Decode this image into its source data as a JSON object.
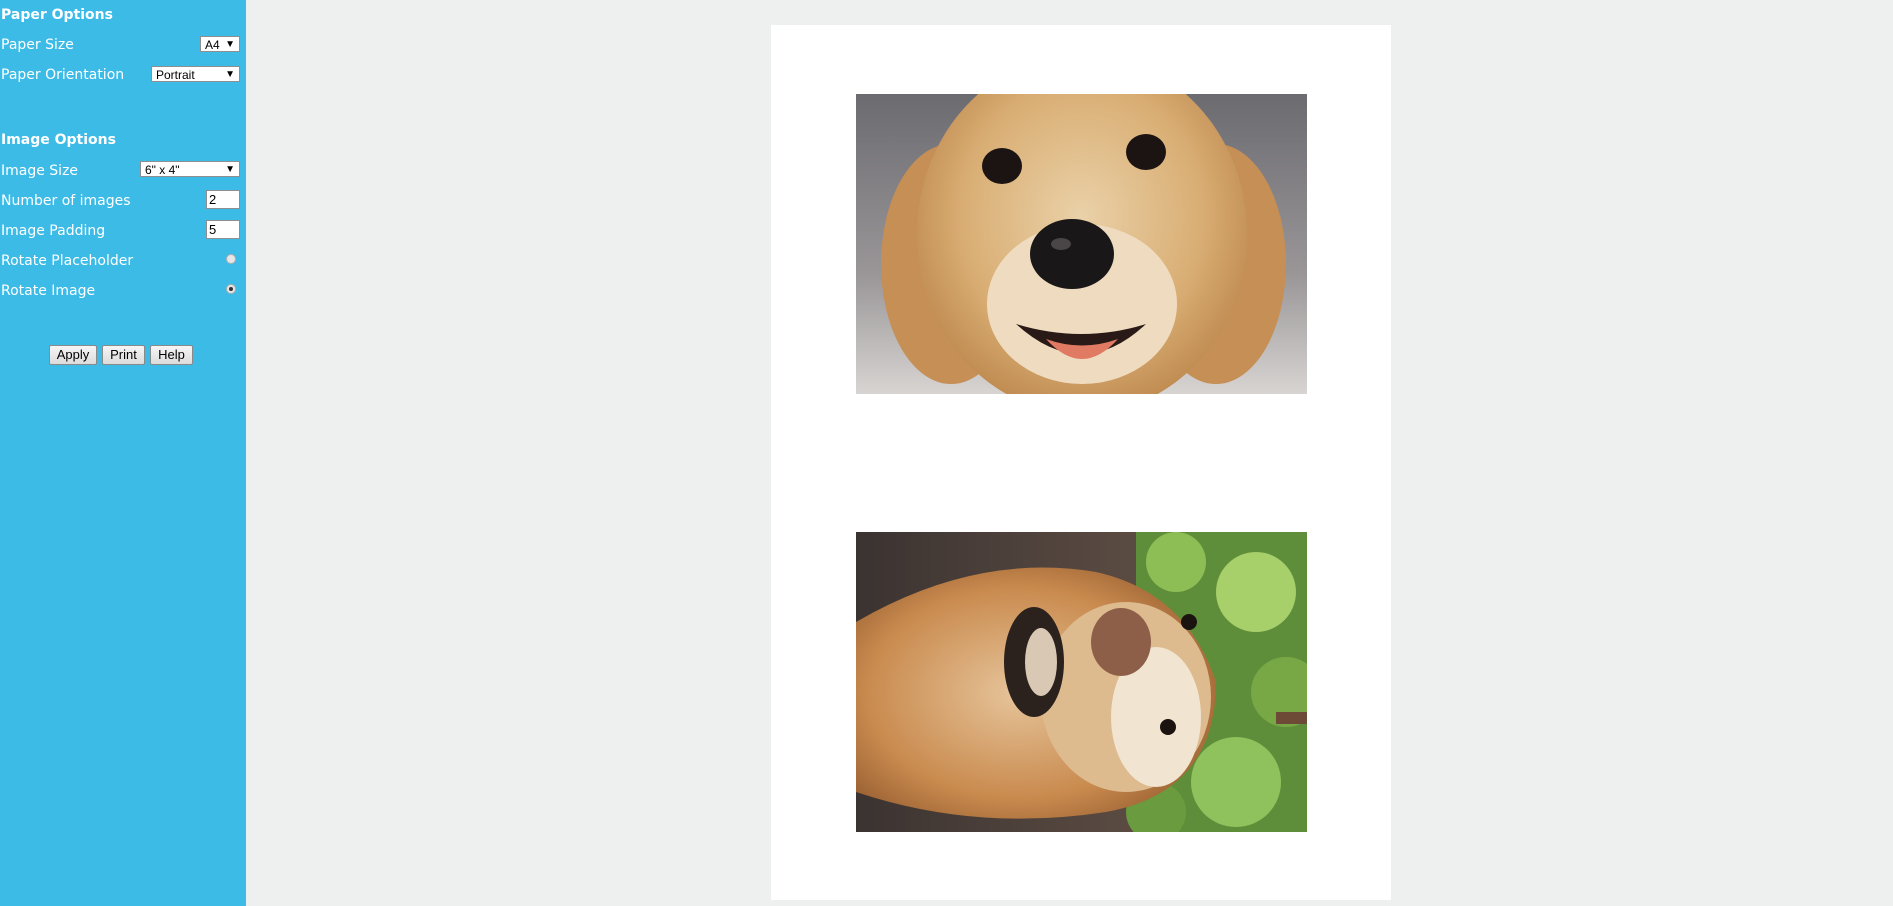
{
  "sidebar": {
    "paper_options": {
      "title": "Paper Options",
      "paper_size_label": "Paper Size",
      "paper_size_value": "A4",
      "orientation_label": "Paper Orientation",
      "orientation_value": "Portrait"
    },
    "image_options": {
      "title": "Image Options",
      "image_size_label": "Image Size",
      "image_size_value": "6\" x 4\"",
      "num_images_label": "Number of images",
      "num_images_value": "2",
      "padding_label": "Image Padding",
      "padding_value": "5",
      "rotate_placeholder_label": "Rotate Placeholder",
      "rotate_placeholder_checked": false,
      "rotate_image_label": "Rotate Image",
      "rotate_image_checked": true
    },
    "buttons": {
      "apply": "Apply",
      "print": "Print",
      "help": "Help"
    }
  },
  "preview": {
    "images": [
      {
        "subject": "golden retriever close-up face"
      },
      {
        "subject": "golden retriever rotated photo outdoors"
      }
    ]
  },
  "colors": {
    "sidebar": "#3dbbe7",
    "background": "#eef0ef",
    "paper": "#ffffff"
  }
}
